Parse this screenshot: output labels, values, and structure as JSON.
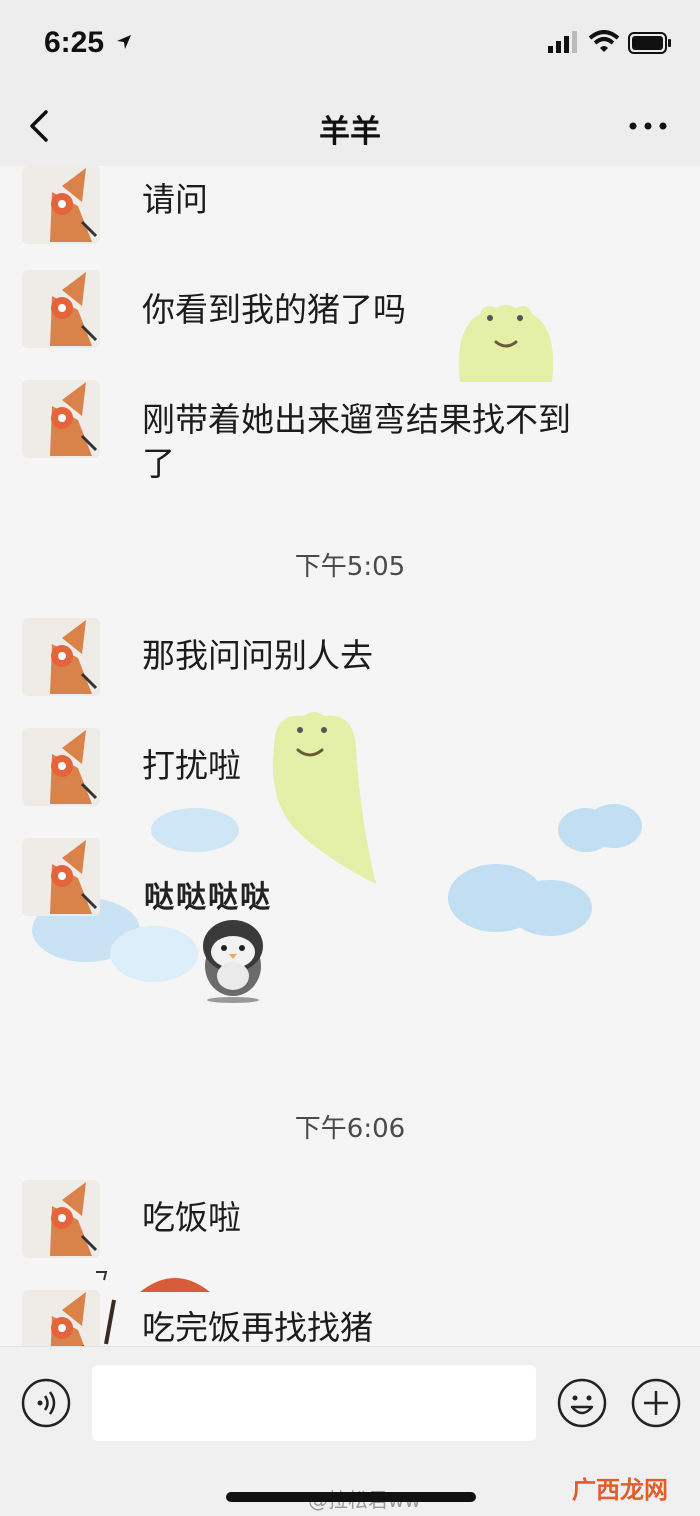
{
  "status_bar": {
    "time": "6:25"
  },
  "nav": {
    "title": "羊羊"
  },
  "messages": [
    {
      "text": "请问"
    },
    {
      "text": "你看到我的猪了吗"
    },
    {
      "text": "刚带着她出来遛弯结果找不到了"
    },
    {
      "text": "那我问问别人去"
    },
    {
      "text": "打扰啦"
    },
    {
      "text": "吃饭啦"
    },
    {
      "text": "吃完饭再找找猪"
    }
  ],
  "timestamps": [
    "下午5:05",
    "下午6:06"
  ],
  "sticker": {
    "text": "哒哒哒哒"
  },
  "watermark": {
    "text": "@拉松君ww",
    "site": "广西龙网"
  },
  "colors": {
    "background": "#f5f5f5",
    "bar": "#ededed",
    "accent_frog": "#e4efa8",
    "cloud": "#c9e3f5"
  }
}
